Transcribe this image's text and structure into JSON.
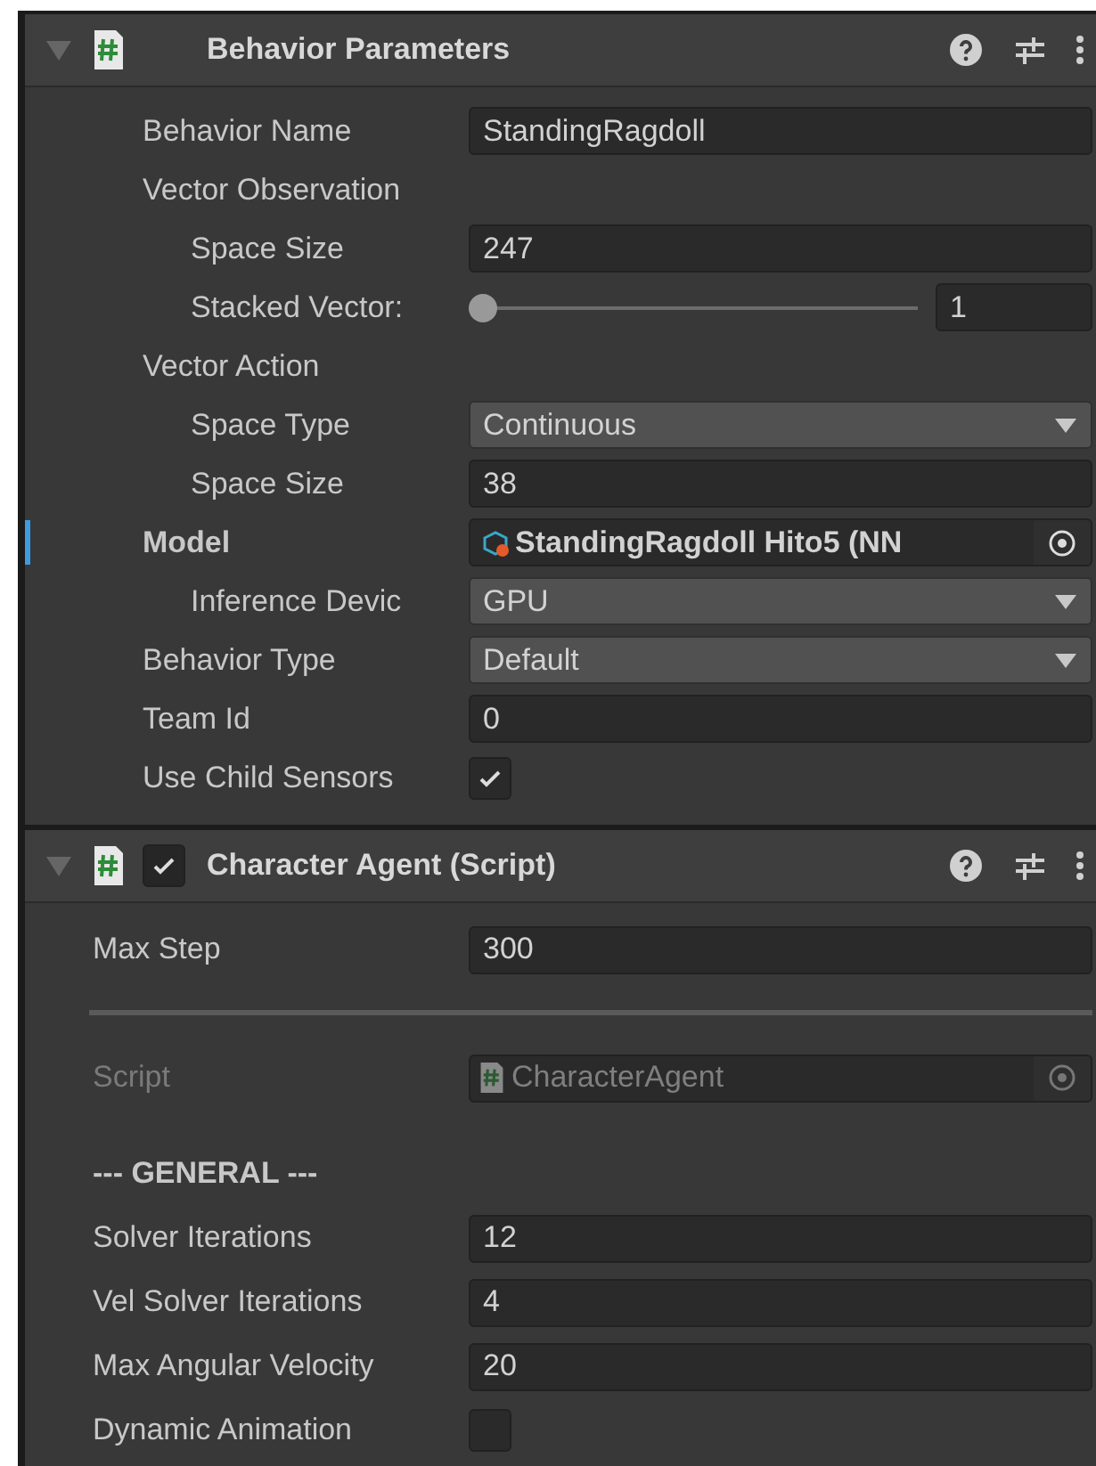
{
  "components": [
    {
      "title": "Behavior Parameters",
      "expanded": true,
      "indented": true,
      "fields": [
        {
          "kind": "text",
          "label": "Behavior Name",
          "value": "StandingRagdoll"
        },
        {
          "kind": "group",
          "label": "Vector Observation",
          "children": [
            {
              "kind": "text",
              "label": "Space Size",
              "value": "247"
            },
            {
              "kind": "slider",
              "label": "Stacked Vector:",
              "level": 0,
              "value": "1"
            }
          ]
        },
        {
          "kind": "group",
          "label": "Vector Action",
          "children": [
            {
              "kind": "dropdown",
              "label": "Space Type",
              "value": "Continuous"
            },
            {
              "kind": "text",
              "label": "Space Size",
              "value": "38"
            }
          ]
        },
        {
          "kind": "object",
          "label": "Model",
          "value": "StandingRagdoll Hito5 (NN",
          "modified": true,
          "children": [
            {
              "kind": "dropdown",
              "label": "Inference Devic",
              "value": "GPU"
            }
          ]
        },
        {
          "kind": "dropdown",
          "label": "Behavior Type",
          "value": "Default"
        },
        {
          "kind": "text",
          "label": "Team Id",
          "value": "0"
        },
        {
          "kind": "checkbox",
          "label": "Use Child Sensors",
          "checked": true
        }
      ]
    },
    {
      "title": "Character Agent (Script)",
      "expanded": true,
      "indented": false,
      "enabled": true,
      "fields": [
        {
          "kind": "text",
          "label": "Max Step",
          "value": "300"
        },
        {
          "kind": "rule"
        },
        {
          "kind": "object",
          "label": "Script",
          "value": "CharacterAgent",
          "disabled": true
        },
        {
          "kind": "heading",
          "label": "--- GENERAL ---"
        },
        {
          "kind": "text",
          "label": "Solver Iterations",
          "value": "12"
        },
        {
          "kind": "text",
          "label": "Vel Solver Iterations",
          "value": "4"
        },
        {
          "kind": "text",
          "label": "Max Angular Velocity",
          "value": "20"
        },
        {
          "kind": "checkbox",
          "label": "Dynamic Animation",
          "checked": false
        }
      ]
    }
  ]
}
